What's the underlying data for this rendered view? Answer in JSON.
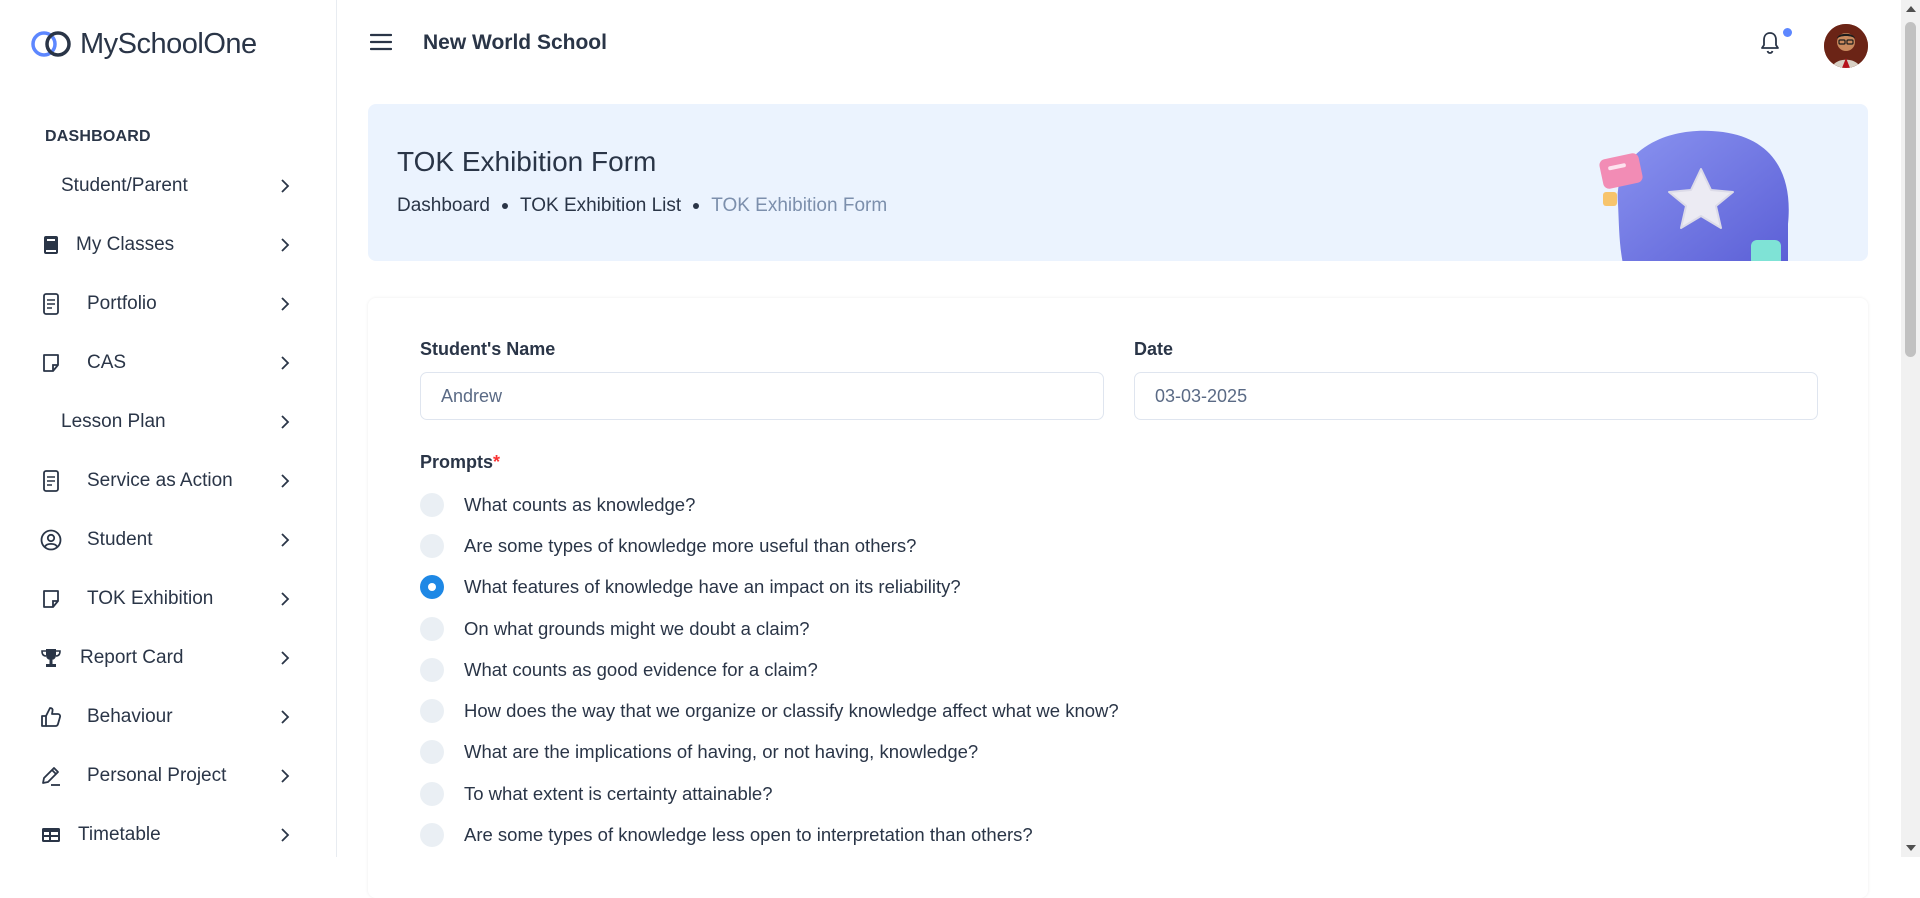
{
  "app": {
    "logo_text": "MySchoolOne",
    "brand_color": "#5d87ff"
  },
  "sidebar": {
    "section_label": "DASHBOARD",
    "items": [
      {
        "label": "Student/Parent",
        "icon": "none"
      },
      {
        "label": "My Classes",
        "icon": "book-icon"
      },
      {
        "label": "Portfolio",
        "icon": "document-icon"
      },
      {
        "label": "CAS",
        "icon": "note-icon"
      },
      {
        "label": "Lesson Plan",
        "icon": "none"
      },
      {
        "label": "Service as Action",
        "icon": "document-icon"
      },
      {
        "label": "Student",
        "icon": "user-circle-icon"
      },
      {
        "label": "TOK Exhibition",
        "icon": "note-icon"
      },
      {
        "label": "Report Card",
        "icon": "trophy-icon"
      },
      {
        "label": "Behaviour",
        "icon": "thumbs-up-icon"
      },
      {
        "label": "Personal Project",
        "icon": "pen-icon"
      },
      {
        "label": "Timetable",
        "icon": "table-icon"
      }
    ]
  },
  "header": {
    "school_name": "New World School",
    "notification_indicator_color": "#5d87ff"
  },
  "banner": {
    "title": "TOK Exhibition Form",
    "breadcrumbs": [
      "Dashboard",
      "TOK Exhibition List",
      "TOK Exhibition Form"
    ]
  },
  "form": {
    "student_name_label": "Student's Name",
    "student_name_value": "Andrew",
    "date_label": "Date",
    "date_value": "03-03-2025",
    "prompts_label": "Prompts",
    "required_mark": "*",
    "selected_prompt_index": 2,
    "prompts": [
      "What counts as knowledge?",
      "Are some types of knowledge more useful than others?",
      "What features of knowledge have an impact on its reliability?",
      "On what grounds might we doubt a claim?",
      "What counts as good evidence for a claim?",
      "How does the way that we organize or classify knowledge affect what we know?",
      "What are the implications of having, or not having, knowledge?",
      "To what extent is certainty attainable?",
      "Are some types of knowledge less open to interpretation than others?"
    ]
  }
}
